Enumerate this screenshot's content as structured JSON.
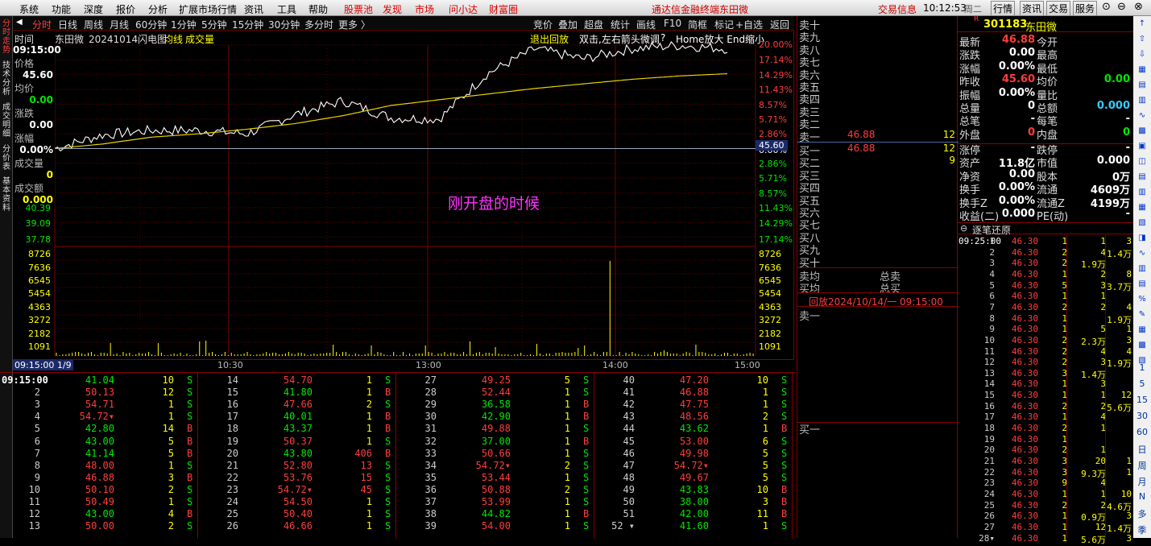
{
  "menu": {
    "items": [
      "系统",
      "功能",
      "深度",
      "报价",
      "分析",
      "扩展市场行情",
      "资讯",
      "工具",
      "帮助"
    ],
    "red_items": [
      "股票池",
      "发现",
      "市场",
      "问小达",
      "财富圈"
    ],
    "app_title": "通达信金融终端",
    "stock_name": "东田微",
    "info_btn": "交易信息",
    "time": "10:12:53",
    "weekday": "周二",
    "right_btns": [
      "行情",
      "资讯",
      "交易",
      "服务"
    ]
  },
  "leftnav": [
    "分时走势",
    "技术分析",
    "成交明细",
    "分价表",
    "基本资料"
  ],
  "tabs": [
    "分时",
    "日线",
    "周线",
    "月线",
    "60分钟",
    "1分钟",
    "5分钟",
    "15分钟",
    "30分钟",
    "多分时",
    "更多 〉"
  ],
  "tabs_right": [
    "竞价",
    "叠加",
    "超盘",
    "统计",
    "画线",
    "F10",
    "简框",
    "标记",
    "+自选",
    "返回"
  ],
  "chart_header": {
    "col_time": "时间",
    "name": "东田微",
    "date_title": "20241014闪电图",
    "avg_label": "均线",
    "vol_label": "成交量",
    "exit_replay": "退出回放",
    "hint": "双击,左右箭头微调",
    "help": "?",
    "zoom_hint": "Home放大 End缩小"
  },
  "left_info": {
    "time": "09:15:00",
    "price_lbl": "价格",
    "price": "45.60",
    "avg_lbl": "均价",
    "avg": "0.00",
    "chg_lbl": "涨跌",
    "chg": "0.00",
    "pct_lbl": "涨幅",
    "pct": "0.00%",
    "vol_lbl": "成交量",
    "vol": "0",
    "amt_lbl": "成交额",
    "amt": "0.000"
  },
  "price_axis_left": [
    "39.09",
    "37.78",
    "8726",
    "7636",
    "6545",
    "5454",
    "4363",
    "3272",
    "2182",
    "1091"
  ],
  "pct_axis_right_up": [
    "20.00%",
    "17.14%",
    "14.29%",
    "11.43%",
    "8.57%",
    "5.71%",
    "2.86%"
  ],
  "pct_axis_right_mid": "0.00%",
  "pct_axis_right_down": [
    "2.86%",
    "5.71%",
    "8.57%",
    "11.43%",
    "14.29%",
    "17.14%"
  ],
  "vol_axis_right": [
    "8726",
    "7636",
    "6545",
    "5454",
    "4363",
    "3272",
    "2182",
    "1091"
  ],
  "left_partial": "40.39",
  "prev_close_tag": "45.60",
  "annotation": "刚开盘的时候",
  "time_axis": {
    "cursor": "09:15:00 1/9",
    "labels": [
      "10:30",
      "13:00",
      "14:00",
      "15:00"
    ]
  },
  "chart_data": {
    "type": "line",
    "x": [
      "09:30",
      "10:00",
      "10:30",
      "11:00",
      "11:30/13:00",
      "13:30",
      "14:00",
      "14:30",
      "15:00"
    ],
    "series": [
      {
        "values": [
          45.6,
          46.8,
          47.2,
          47.2,
          46.9,
          48.6,
          49.8,
          48.3,
          48.2,
          52.2,
          54.4,
          53.5,
          54.4,
          54.7,
          54.4
        ]
      },
      {
        "values": [
          45.6,
          46.0,
          46.6,
          46.9,
          47.3,
          47.8,
          48.5,
          49.4,
          49.9,
          50.4,
          50.9,
          51.3,
          51.7,
          52.0,
          52.2
        ]
      }
    ],
    "ylim": [
      36.48,
      54.72
    ]
  },
  "ticks_start": "09:15:00",
  "ticks": [
    [
      [
        "",
        "41.04",
        "10",
        "S",
        "g"
      ],
      [
        "2",
        "50.13",
        "12",
        "S",
        "r"
      ],
      [
        "3",
        "54.71",
        "1",
        "S",
        "r"
      ],
      [
        "4",
        "54.72▾",
        "1",
        "S",
        "r"
      ],
      [
        "5",
        "42.80",
        "14",
        "B",
        "g"
      ],
      [
        "6",
        "43.00",
        "5",
        "B",
        "g"
      ],
      [
        "7",
        "41.14",
        "5",
        "B",
        "g"
      ],
      [
        "8",
        "48.00",
        "1",
        "S",
        "r"
      ],
      [
        "9",
        "46.88",
        "3",
        "B",
        "r"
      ],
      [
        "10",
        "50.10",
        "2",
        "S",
        "r"
      ],
      [
        "11",
        "50.49",
        "1",
        "S",
        "r"
      ],
      [
        "12",
        "43.00",
        "4",
        "B",
        "g"
      ],
      [
        "13",
        "50.00",
        "2",
        "S",
        "r"
      ]
    ],
    [
      [
        "14",
        "54.70",
        "1",
        "S",
        "r"
      ],
      [
        "15",
        "41.80",
        "1",
        "B",
        "g"
      ],
      [
        "16",
        "47.66",
        "2",
        "S",
        "r"
      ],
      [
        "17",
        "40.01",
        "1",
        "B",
        "g"
      ],
      [
        "18",
        "43.37",
        "1",
        "B",
        "g"
      ],
      [
        "19",
        "50.37",
        "1",
        "S",
        "r"
      ],
      [
        "20",
        "43.80",
        "406",
        "B",
        "g"
      ],
      [
        "21",
        "52.80",
        "13",
        "S",
        "r"
      ],
      [
        "22",
        "53.76",
        "15",
        "S",
        "r"
      ],
      [
        "23",
        "54.72▾",
        "45",
        "S",
        "r"
      ],
      [
        "24",
        "54.50",
        "1",
        "S",
        "r"
      ],
      [
        "25",
        "50.40",
        "1",
        "S",
        "r"
      ],
      [
        "26",
        "46.66",
        "1",
        "S",
        "r"
      ]
    ],
    [
      [
        "27",
        "49.25",
        "5",
        "S",
        "r"
      ],
      [
        "28",
        "52.44",
        "1",
        "S",
        "r"
      ],
      [
        "29",
        "36.58",
        "1",
        "B",
        "g"
      ],
      [
        "30",
        "42.90",
        "1",
        "B",
        "g"
      ],
      [
        "31",
        "49.88",
        "1",
        "S",
        "r"
      ],
      [
        "32",
        "37.00",
        "1",
        "B",
        "g"
      ],
      [
        "33",
        "50.66",
        "1",
        "S",
        "r"
      ],
      [
        "34",
        "54.72▾",
        "2",
        "S",
        "r"
      ],
      [
        "35",
        "53.44",
        "1",
        "S",
        "r"
      ],
      [
        "36",
        "50.88",
        "2",
        "S",
        "r"
      ],
      [
        "37",
        "53.99",
        "1",
        "S",
        "r"
      ],
      [
        "38",
        "44.82",
        "1",
        "B",
        "g"
      ],
      [
        "39",
        "54.00",
        "1",
        "S",
        "r"
      ]
    ],
    [
      [
        "40",
        "47.20",
        "10",
        "S",
        "r"
      ],
      [
        "41",
        "46.88",
        "1",
        "S",
        "r"
      ],
      [
        "42",
        "47.75",
        "1",
        "S",
        "r"
      ],
      [
        "43",
        "48.56",
        "2",
        "S",
        "r"
      ],
      [
        "44",
        "43.62",
        "1",
        "B",
        "g"
      ],
      [
        "45",
        "53.00",
        "6",
        "S",
        "r"
      ],
      [
        "46",
        "49.98",
        "5",
        "S",
        "r"
      ],
      [
        "47",
        "54.72▾",
        "5",
        "S",
        "r"
      ],
      [
        "48",
        "49.67",
        "5",
        "S",
        "r"
      ],
      [
        "49",
        "43.83",
        "10",
        "B",
        "g"
      ],
      [
        "50",
        "38.00",
        "3",
        "B",
        "g"
      ],
      [
        "51",
        "42.00",
        "11",
        "B",
        "g"
      ],
      [
        "52 ▾",
        "41.60",
        "1",
        "S",
        "g"
      ]
    ]
  ],
  "depth": {
    "sell": [
      "卖十",
      "卖九",
      "卖八",
      "卖七",
      "卖六",
      "卖五",
      "卖四",
      "卖三",
      "卖二",
      "卖一"
    ],
    "buy": [
      "买一",
      "买二",
      "买三",
      "买四",
      "买五",
      "买六",
      "买七",
      "买八",
      "买九",
      "买十"
    ],
    "sell1_price": "46.88",
    "sell1_vol": "12",
    "buy1_price": "46.88",
    "buy1_vol": "12",
    "buy2_vol": "9",
    "sell_avg": "卖均",
    "buy_avg": "买均",
    "total_sell": "总卖",
    "total_buy": "总买",
    "replay": "回放2024/10/14/一  09:15:00",
    "sell1_lbl": "卖一",
    "buy1_lbl": "买一"
  },
  "quote": {
    "code": "301183",
    "name": "东田微",
    "rows": [
      [
        "最新",
        "46.88",
        "今开",
        ""
      ],
      [
        "涨跌",
        "0.00",
        "最高",
        ""
      ],
      [
        "涨幅",
        "0.00%",
        "最低",
        ""
      ],
      [
        "昨收",
        "45.60",
        "均价",
        "0.00"
      ],
      [
        "振幅",
        "0.00%",
        "量比",
        ""
      ],
      [
        "总量",
        "0",
        "总额",
        "0.000"
      ],
      [
        "总笔",
        "-",
        "每笔",
        "-"
      ],
      [
        "外盘",
        "0",
        "内盘",
        "0"
      ]
    ],
    "rows2": [
      [
        "涨停",
        "-",
        "跌停",
        "-"
      ],
      [
        "资产",
        "11.8亿",
        "市值",
        "0.000"
      ],
      [
        "净资",
        "0.00",
        "股本",
        "0万"
      ],
      [
        "换手",
        "0.00%",
        "流通",
        "4609万"
      ],
      [
        "换手Z",
        "0.00%",
        "流通Z",
        "4199万"
      ],
      [
        "收益(二)",
        "0.000",
        "PE(动)",
        "-"
      ]
    ],
    "trades_title": "逐笔还原",
    "trades_time": "09:25:00",
    "trades": [
      [
        "1",
        "46.30",
        "1",
        "1",
        "3"
      ],
      [
        "2",
        "46.30",
        "2",
        "4",
        "1.4万"
      ],
      [
        "3",
        "46.30",
        "2",
        "1.9万",
        ""
      ],
      [
        "4",
        "46.30",
        "1",
        "2",
        "8"
      ],
      [
        "5",
        "46.30",
        "5",
        "3",
        "3.7万"
      ],
      [
        "6",
        "46.30",
        "1",
        "1",
        ""
      ],
      [
        "7",
        "46.30",
        "2",
        "2",
        "4"
      ],
      [
        "8",
        "46.30",
        "1",
        "",
        "1.9万"
      ],
      [
        "9",
        "46.30",
        "1",
        "5",
        "1"
      ],
      [
        "10",
        "46.30",
        "2",
        "2.3万",
        "3"
      ],
      [
        "11",
        "46.30",
        "2",
        "4",
        "4"
      ],
      [
        "12",
        "46.30",
        "2",
        "3",
        "1.9万"
      ],
      [
        "13",
        "46.30",
        "3",
        "1.4万",
        ""
      ],
      [
        "14",
        "46.30",
        "1",
        "3",
        ""
      ],
      [
        "15",
        "46.30",
        "1",
        "1",
        "12"
      ],
      [
        "16",
        "46.30",
        "2",
        "2",
        "5.6万"
      ],
      [
        "17",
        "46.30",
        "1",
        "4",
        ""
      ],
      [
        "18",
        "46.30",
        "2",
        "1",
        ""
      ],
      [
        "19",
        "46.30",
        "1",
        "",
        ""
      ],
      [
        "20",
        "46.30",
        "2",
        "1",
        ""
      ],
      [
        "21",
        "46.30",
        "3",
        "20",
        "1"
      ],
      [
        "22",
        "46.30",
        "3",
        "9.3万",
        "1"
      ],
      [
        "23",
        "46.30",
        "9",
        "4",
        ""
      ],
      [
        "24",
        "46.30",
        "1",
        "1",
        "10"
      ],
      [
        "25",
        "46.30",
        "2",
        "2",
        "4.6万"
      ],
      [
        "26",
        "46.30",
        "1",
        "0.9万",
        "3"
      ],
      [
        "27",
        "46.30",
        "1",
        "12",
        "1.4万"
      ],
      [
        "28▾",
        "46.30",
        "1",
        "5.6万",
        "3"
      ]
    ]
  },
  "rightbar_text": [
    "1",
    "5",
    "15",
    "30",
    "60",
    "日",
    "周",
    "月",
    "N",
    "多",
    "季"
  ]
}
